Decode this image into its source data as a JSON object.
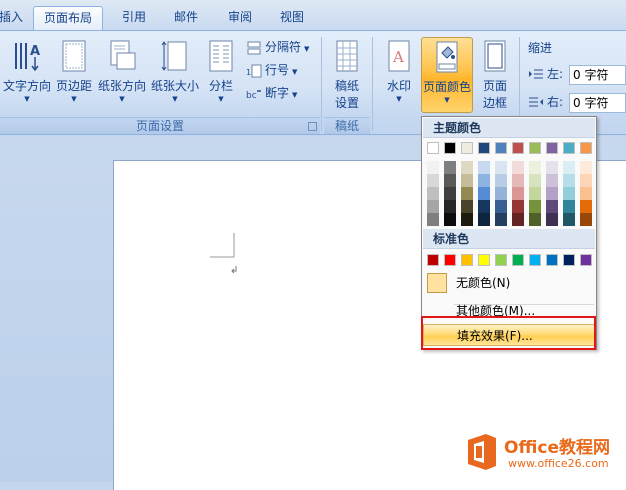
{
  "tabs": [
    {
      "label": "插入",
      "active": false
    },
    {
      "label": "页面布局",
      "active": true
    },
    {
      "label": "引用",
      "active": false
    },
    {
      "label": "邮件",
      "active": false
    },
    {
      "label": "审阅",
      "active": false
    },
    {
      "label": "视图",
      "active": false
    }
  ],
  "page_setup": {
    "text_direction": "文字方向",
    "margins": "页边距",
    "orientation": "纸张方向",
    "size": "纸张大小",
    "columns": "分栏",
    "breaks": "分隔符",
    "line_numbers": "行号",
    "hyphenation": "断字",
    "group_label": "页面设置"
  },
  "paper": {
    "manuscript_line1": "稿纸",
    "manuscript_line2": "设置",
    "group_label": "稿纸"
  },
  "page_background": {
    "watermark": "水印",
    "page_color": "页面颜色",
    "page_borders_line1": "页面",
    "page_borders_line2": "边框"
  },
  "indent": {
    "title": "缩进",
    "left_label": "左:",
    "left_value": "0 字符",
    "right_label": "右:",
    "right_value": "0 字符"
  },
  "color_menu": {
    "theme_header": "主题颜色",
    "standard_header": "标准色",
    "no_color": "无颜色(N)",
    "more_colors": "其他颜色(M)...",
    "fill_effects": "填充效果(F)...",
    "theme_top": [
      "#ffffff",
      "#000000",
      "#eeece1",
      "#1f497d",
      "#4f81bd",
      "#c0504d",
      "#9bbb59",
      "#8064a2",
      "#4bacc6",
      "#f79646"
    ],
    "theme_shades": [
      [
        "#f2f2f2",
        "#d8d8d8",
        "#bfbfbf",
        "#a5a5a5",
        "#7f7f7f"
      ],
      [
        "#7f7f7f",
        "#595959",
        "#3f3f3f",
        "#262626",
        "#0c0c0c"
      ],
      [
        "#ddd9c3",
        "#c4bd97",
        "#938953",
        "#494429",
        "#1d1b10"
      ],
      [
        "#c6d9f0",
        "#8db3e2",
        "#548dd4",
        "#17365d",
        "#0f243e"
      ],
      [
        "#dbe5f1",
        "#b8cce4",
        "#95b3d7",
        "#366092",
        "#244061"
      ],
      [
        "#f2dcdb",
        "#e5b9b7",
        "#d99694",
        "#953734",
        "#632423"
      ],
      [
        "#ebf1dd",
        "#d7e3bc",
        "#c3d69b",
        "#76923c",
        "#4f6128"
      ],
      [
        "#e5e0ec",
        "#ccc1d9",
        "#b2a2c7",
        "#5f497a",
        "#3f3151"
      ],
      [
        "#dbeef3",
        "#b7dde8",
        "#92cddc",
        "#31859b",
        "#205867"
      ],
      [
        "#fdeada",
        "#fbd5b5",
        "#fac08f",
        "#e36c09",
        "#974806"
      ]
    ],
    "standard": [
      "#c00000",
      "#ff0000",
      "#ffc000",
      "#ffff00",
      "#92d050",
      "#00b050",
      "#00b0f0",
      "#0070c0",
      "#002060",
      "#7030a0"
    ]
  },
  "watermark_logo": {
    "brand": "Office教程网",
    "url": "www.office26.com"
  }
}
